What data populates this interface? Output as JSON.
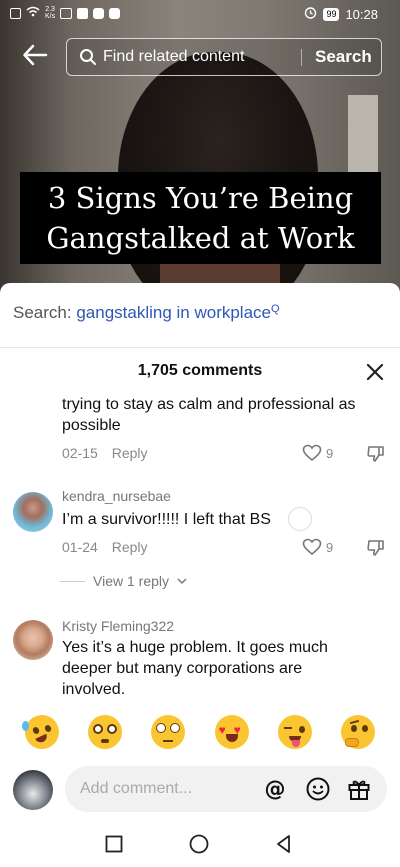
{
  "status_bar": {
    "net_speed_value": "2.3",
    "net_speed_unit": "K/s",
    "battery": "99",
    "time": "10:28"
  },
  "header": {
    "search_placeholder": "Find related content",
    "search_button": "Search"
  },
  "video": {
    "title_line1": "3 Signs You’re Being",
    "title_line2": "Gangstalked at Work"
  },
  "related_search": {
    "prefix": "Search:",
    "term": "gangstakling in workplace",
    "badge": "Q"
  },
  "comments_header": {
    "count_label": "1,705 comments"
  },
  "comments": [
    {
      "text_line1": "trying to stay as calm and professional as",
      "text_line2": "possible",
      "date": "02-15",
      "reply_label": "Reply",
      "likes": "9"
    },
    {
      "username": "kendra_nursebae",
      "text": "I’m a survivor!!!!! I left that BS",
      "date": "01-24",
      "reply_label": "Reply",
      "likes": "9",
      "view_replies": "View 1 reply"
    },
    {
      "username": "Kristy Fleming322",
      "text_line1": "Yes it’s a huge problem. It goes much",
      "text_line2": "deeper but many corporations are",
      "text_line3": "involved."
    }
  ],
  "emojis": [
    "rofl-emoji",
    "flushed-emoji",
    "eye-roll-emoji",
    "heart-eyes-emoji",
    "wink-tongue-emoji",
    "thinking-emoji"
  ],
  "input": {
    "placeholder": "Add comment..."
  },
  "colors": {
    "accent_blue": "#2e57b8",
    "muted_text": "#888888",
    "sheet_bg": "#ffffff"
  }
}
